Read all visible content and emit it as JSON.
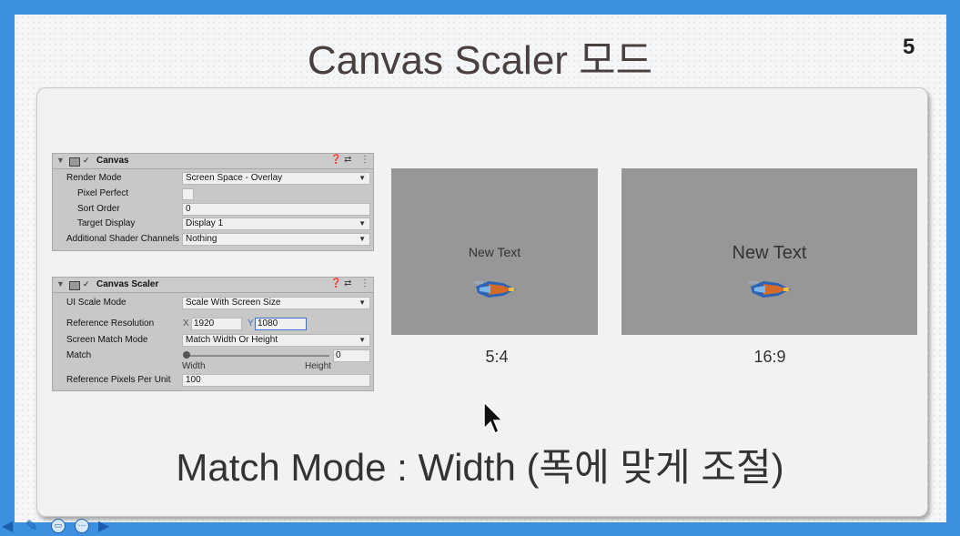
{
  "slide": {
    "title": "Canvas Scaler 모드",
    "page_number": "5",
    "caption": "Match Mode : Width (폭에 맞게 조절)"
  },
  "canvas_component": {
    "name": "Canvas",
    "rows": {
      "render_mode": {
        "label": "Render Mode",
        "value": "Screen Space - Overlay"
      },
      "pixel_perfect": {
        "label": "Pixel Perfect",
        "checked": false
      },
      "sort_order": {
        "label": "Sort Order",
        "value": "0"
      },
      "target_display": {
        "label": "Target Display",
        "value": "Display 1"
      },
      "shader_channels": {
        "label": "Additional Shader Channels",
        "value": "Nothing"
      }
    }
  },
  "canvas_scaler_component": {
    "name": "Canvas Scaler",
    "rows": {
      "ui_scale_mode": {
        "label": "UI Scale Mode",
        "value": "Scale With Screen Size"
      },
      "ref_resolution": {
        "label": "Reference Resolution",
        "x_label": "X",
        "x": "1920",
        "y_label": "Y",
        "y": "1080"
      },
      "screen_match_mode": {
        "label": "Screen Match Mode",
        "value": "Match Width Or Height"
      },
      "match": {
        "label": "Match",
        "value": "0",
        "min_label": "Width",
        "max_label": "Height",
        "level": 0
      },
      "ref_ppu": {
        "label": "Reference Pixels Per Unit",
        "value": "100"
      }
    }
  },
  "previews": [
    {
      "text": "New Text",
      "ratio": "5:4"
    },
    {
      "text": "New Text",
      "ratio": "16:9"
    }
  ],
  "icons": {
    "help": "help-icon",
    "preset": "preset-icon",
    "menu": "kebab-menu-icon",
    "check": "✓",
    "dropdown": "▼",
    "collapse": "▼"
  }
}
